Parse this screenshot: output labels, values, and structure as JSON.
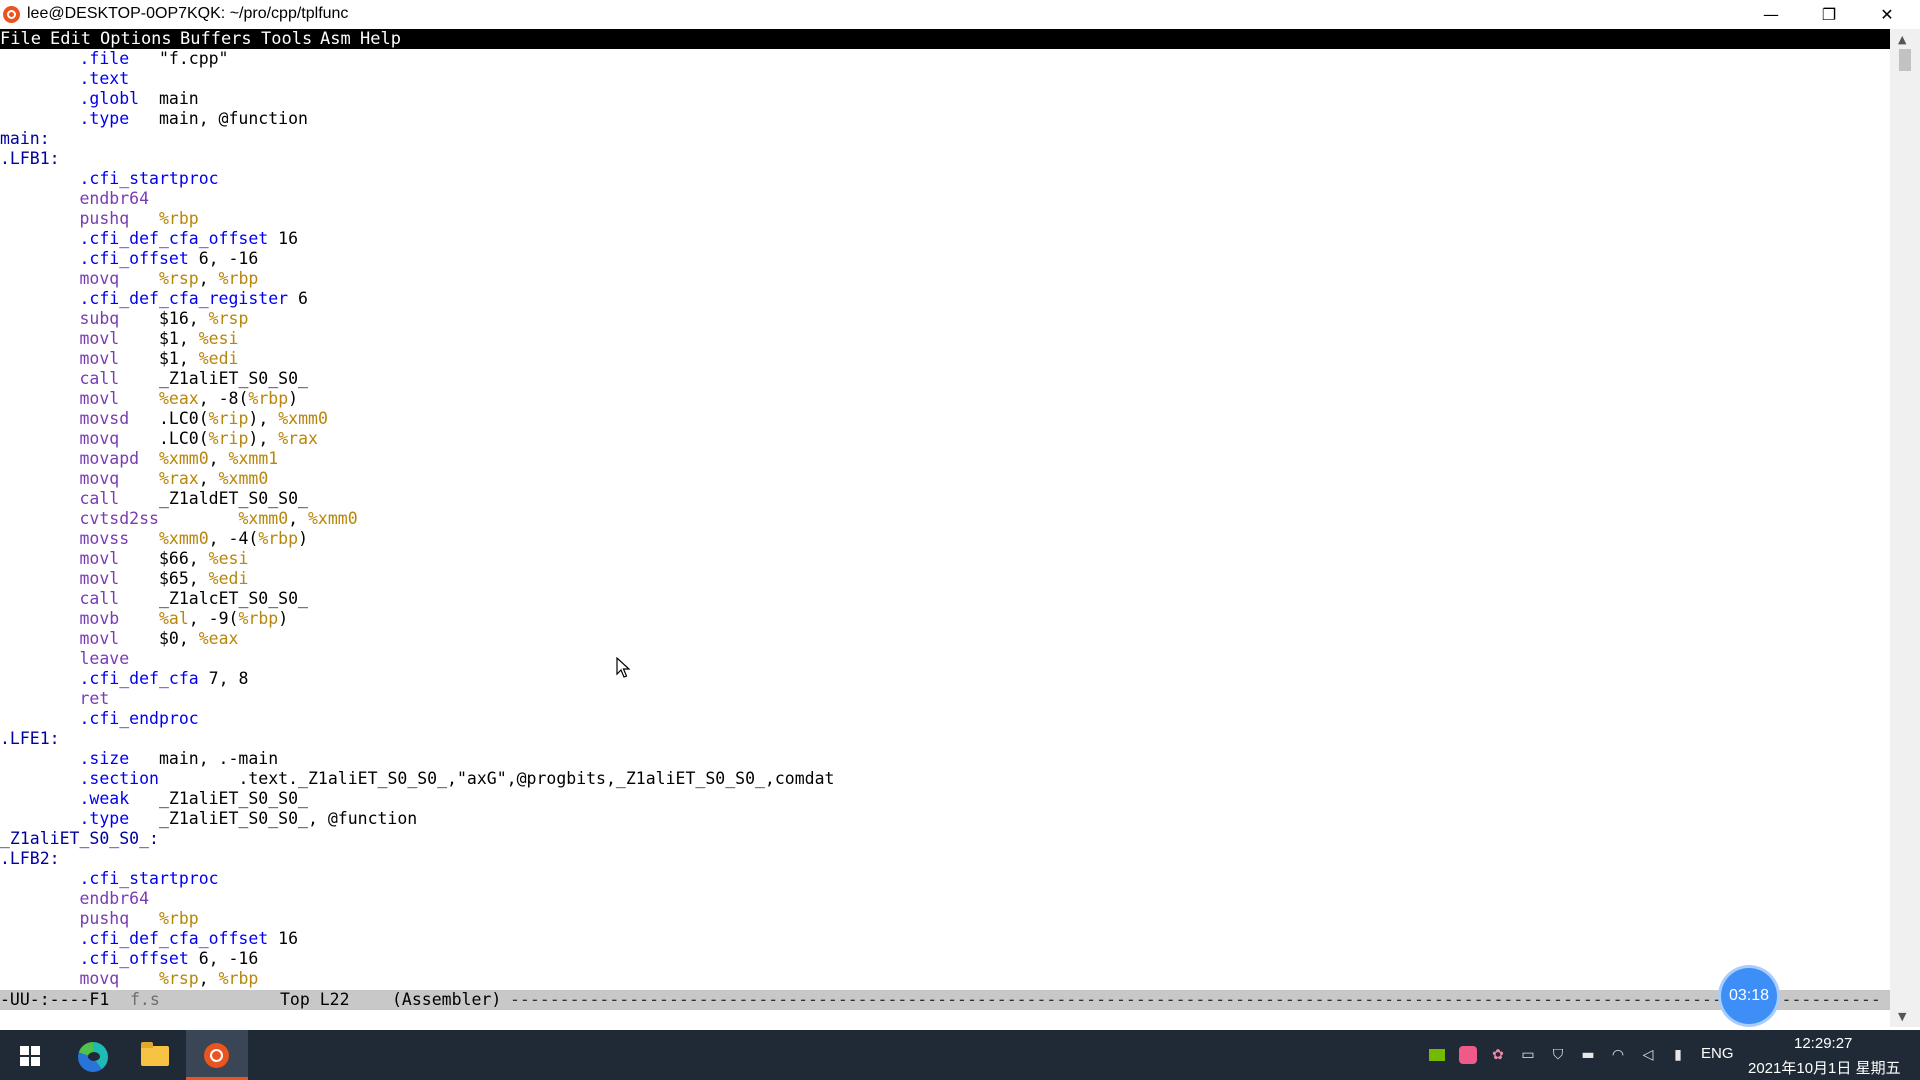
{
  "window": {
    "title": "lee@DESKTOP-0OP7KQK: ~/pro/cpp/tplfunc",
    "minimize_glyph": "—",
    "restore_glyph": "❐",
    "close_glyph": "✕"
  },
  "menu": [
    "File",
    "Edit",
    "Options",
    "Buffers",
    "Tools",
    "Asm",
    "Help"
  ],
  "code_lines": [
    "\t.file\t\"f.cpp\"",
    "\t.text",
    "\t.globl\tmain",
    "\t.type\tmain, @function",
    "main:",
    ".LFB1:",
    "\t.cfi_startproc",
    "\tendbr64",
    "\tpushq\t%rbp",
    "\t.cfi_def_cfa_offset 16",
    "\t.cfi_offset 6, -16",
    "\tmovq\t%rsp, %rbp",
    "\t.cfi_def_cfa_register 6",
    "\tsubq\t$16, %rsp",
    "\tmovl\t$1, %esi",
    "\tmovl\t$1, %edi",
    "\tcall\t_Z1aliET_S0_S0_",
    "\tmovl\t%eax, -8(%rbp)",
    "\tmovsd\t.LC0(%rip), %xmm0",
    "\tmovq\t.LC0(%rip), %rax",
    "\tmovapd\t%xmm0, %xmm1",
    "\tmovq\t%rax, %xmm0",
    "\tcall\t_Z1aldET_S0_S0_",
    "\tcvtsd2ss\t%xmm0, %xmm0",
    "\tmovss\t%xmm0, -4(%rbp)",
    "\tmovl\t$66, %esi",
    "\tmovl\t$65, %edi",
    "\tcall\t_Z1alcET_S0_S0_",
    "\tmovb\t%al, -9(%rbp)",
    "\tmovl\t$0, %eax",
    "\tleave",
    "\t.cfi_def_cfa 7, 8",
    "\tret",
    "\t.cfi_endproc",
    ".LFE1:",
    "\t.size\tmain, .-main",
    "\t.section\t.text._Z1aliET_S0_S0_,\"axG\",@progbits,_Z1aliET_S0_S0_,comdat",
    "\t.weak\t_Z1aliET_S0_S0_",
    "\t.type\t_Z1aliET_S0_S0_, @function",
    "_Z1aliET_S0_S0_:",
    ".LFB2:",
    "\t.cfi_startproc",
    "\tendbr64",
    "\tpushq\t%rbp",
    "\t.cfi_def_cfa_offset 16",
    "\t.cfi_offset 6, -16",
    "\tmovq\t%rsp, %rbp"
  ],
  "modeline": {
    "status": "-UU-:----F1",
    "filename": "f.s",
    "position": "Top L22",
    "mode": "(Assembler)"
  },
  "recording_badge": "03:18",
  "taskbar": {
    "language": "ENG",
    "time": "12:29:27",
    "date": "2021年10月1日 星期五"
  },
  "colors": {
    "directive": "#0000ee",
    "instruction": "#7a3bb5",
    "register": "#b8860b",
    "label": "#00009e",
    "menubar_bg": "#000000",
    "modeline_bg": "#c8c8c8",
    "taskbar_bg": "#202a37",
    "ubuntu_orange": "#e95420"
  }
}
